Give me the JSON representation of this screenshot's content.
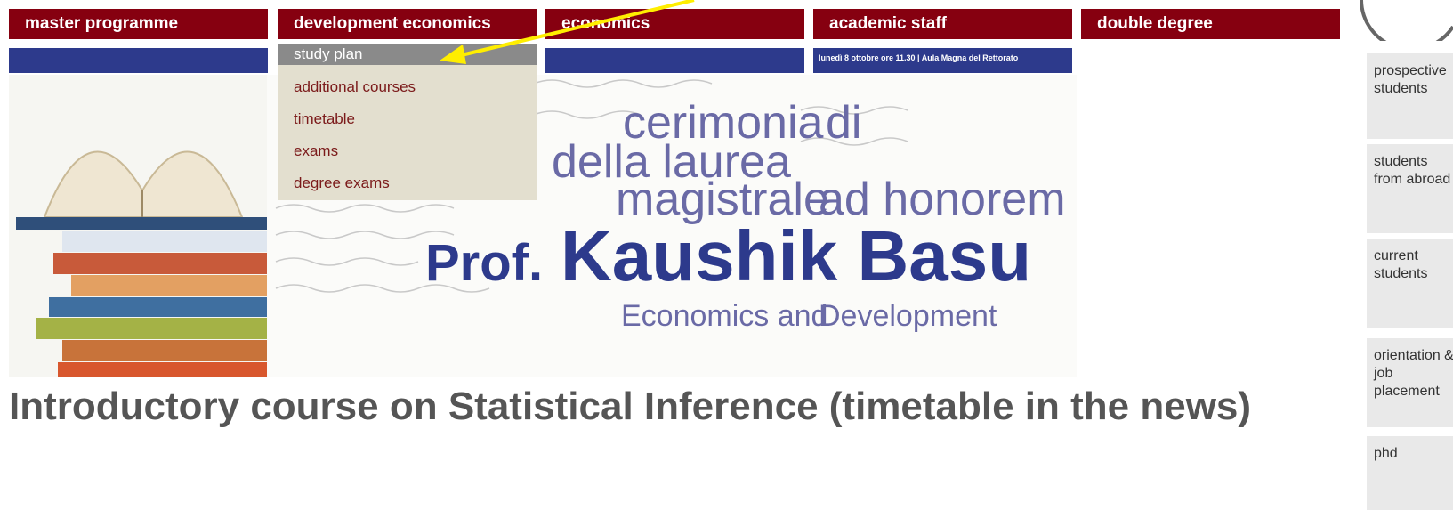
{
  "nav": {
    "tabs": [
      {
        "label": "master programme"
      },
      {
        "label": "development economics"
      },
      {
        "label": "economics"
      },
      {
        "label": "academic staff"
      },
      {
        "label": "double degree"
      }
    ]
  },
  "dropdown": {
    "items": [
      {
        "label": "study plan"
      },
      {
        "label": "additional courses"
      },
      {
        "label": "timetable"
      },
      {
        "label": "exams"
      },
      {
        "label": "degree exams"
      }
    ]
  },
  "banner": {
    "event_line": "lunedì 8 ottobre ore 11.30 | Aula Magna del Rettorato",
    "line1a": "cerimonia",
    "line1b": "di",
    "line2": "della laurea",
    "line3a": "magistrale",
    "line3b": "ad honorem",
    "prof": "Prof.",
    "name": "Kaushik Basu",
    "subtitle_a": "Economics and",
    "subtitle_b": "Development"
  },
  "page_title": "Introductory course on Statistical Inference (timetable in the news)",
  "sidebar": {
    "items": [
      {
        "label": "prospective students"
      },
      {
        "label": "students from abroad"
      },
      {
        "label": "current students"
      },
      {
        "label": "orientation & job placement"
      },
      {
        "label": "phd"
      }
    ]
  },
  "colors": {
    "nav_bg": "#860010",
    "blue_bar": "#2d3a8c",
    "dropdown_bg": "#e3dfcf",
    "dropdown_active": "#8a8a8a",
    "banner_blue": "#2d3a8c",
    "banner_purple": "#6a6aa6",
    "annotation_arrow": "#ffee00"
  }
}
